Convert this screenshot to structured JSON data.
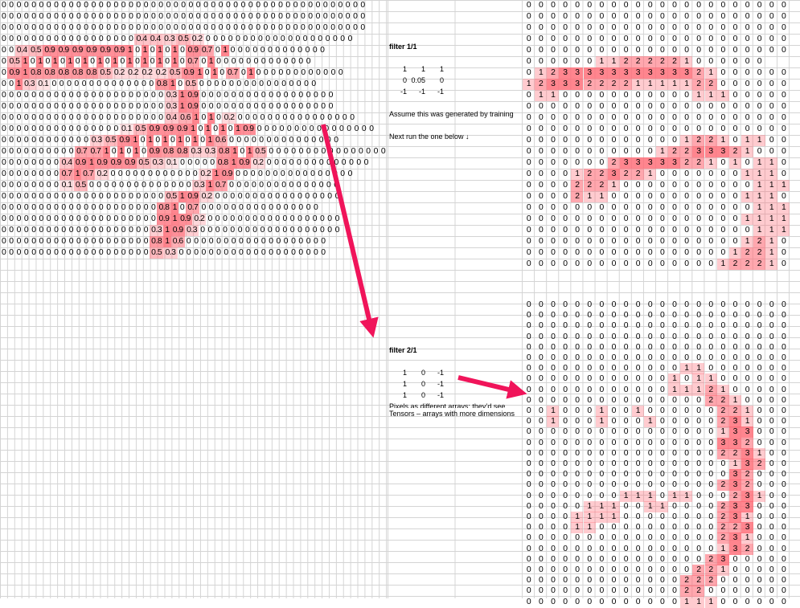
{
  "main_matrix": {
    "rows": [
      "0000000000000000000000000000000000000000000000000",
      "0000000000000000000000000000000000000000000000000",
      "0000000000000000000000000000000000000000000000000",
      "0000000000000000000.40.40.30.50.200000000000000000000",
      "000.40.50.90.90.90.90.90.9101010100.90.7010000000000000",
      "00.510101010101010101010100.7010000000000000",
      "00.910.80.80.80.80.80.50.20.20.20.20.50.910100.701000000000000",
      "0010.30.1000000000000000.8100.50000000000000000",
      "00000000000000000000000.310.9000000000000000000",
      "00000000000000000000000.310.9000000000000000000",
      "00000000000000000000000.40.610100.20000000000000000",
      "00000000000000000.10.50.90.90.910101010.90000000000000000",
      "0000000000000.30.50.9101010101010.6000000000000000",
      "00000000000.70.71010100.90.80.80.30.30.81010.50000000000000000",
      "000000000.40.910.90.90.90.50.30.1000000.810.90.200000000000000",
      "000000000.710.70.20000000000000.210.90000000000000000",
      "000000000.10.5000000000000000.310.7000000000000000",
      "00000000000000000000000.510.90.200000000000000000",
      "0000000000000000000000.8100.70000000000000000",
      "0000000000000000000000.910.90.2000000000000000000",
      "000000000000000000000.310.90.30000000000000000000",
      "000000000000000000000.810.60000000000000000000",
      "000000000000000000000.50.300000000000000000000"
    ]
  },
  "filter1": {
    "title": "filter 1/1",
    "rows": [
      [
        "1",
        "1",
        "1"
      ],
      [
        "0",
        "0.05",
        "0"
      ],
      [
        "-1",
        "-1",
        "-1"
      ]
    ],
    "note1": "Assume this was generated by training",
    "note2": "Next run the one below ↓"
  },
  "filter2": {
    "title": "filter 2/1",
    "rows": [
      [
        "1",
        "0",
        "-1"
      ],
      [
        "1",
        "0",
        "-1"
      ],
      [
        "1",
        "0",
        "-1"
      ]
    ],
    "note1": "Pixels as different arrays; they’d see",
    "note2": "Tensors – arrays with more dimensions"
  },
  "output1": {
    "rows": [
      "0000000000000000000000",
      "0000000000000000000000",
      "0000000000000000000000",
      "0000000000000000000000",
      "0000000000000000000000",
      "00000011222221000000",
      "0123333333333321000000",
      "1233322221111122000000",
      "0110000000000011100000",
      "0000000000000000000000",
      "0000000000000000000000",
      "0000000000000000000000",
      "0000000000000122101100",
      "0000000000012233321000",
      "0000000233333221010110",
      "0000122322100000001110",
      "0000222100000000000111",
      "0000211000000000001110",
      "0000000000000000000111",
      "0000000000000000001111",
      "0000000000000000000111",
      "0000000000000000001210",
      "0000000000000000012210",
      "0000000000000000122210"
    ]
  },
  "output2": {
    "rows": [
      "0000000000000000000000",
      "0000000000000000000000",
      "0000000000000000000000",
      "0000000000000000000000",
      "0000000000000000000000",
      "0000000000000000000000",
      "0000000000000110000000",
      "0000000000001011000000",
      "0000000000001112100000",
      "0000000000000002210000",
      "0010001001000000221000",
      "0010001000100000231000",
      "0000000000000000133000",
      "0000000000000000332000",
      "0000000000000000223100",
      "0000000000000000013200",
      "0000000000000000032000",
      "0000000000000000232000",
      "0000000011101100023100",
      "0000011100110000233000",
      "0000111100000000231000",
      "0000110000000000223000",
      "0000000000000000231000",
      "0000000000000000132000",
      "0000000000000002300000",
      "0000000000000022100000",
      "0000000000000222000000",
      "0000000000000220000000",
      "0000000000000111000000"
    ]
  },
  "colors": {
    "heat": "#ff6a75",
    "arrow": "#f0145a",
    "grid": "#d4d4d4"
  }
}
